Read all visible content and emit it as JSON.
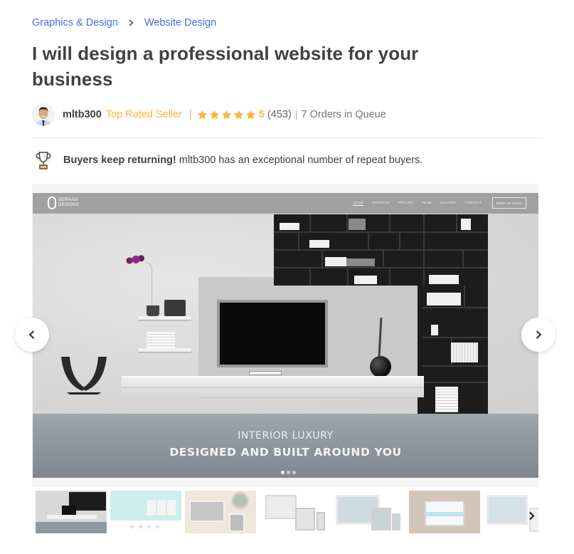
{
  "breadcrumb": {
    "items": [
      {
        "label": "Graphics & Design"
      },
      {
        "label": "Website Design"
      }
    ],
    "separator_icon": "chevron-right-icon"
  },
  "gig": {
    "title": "I will design a professional website for your business"
  },
  "seller": {
    "name": "mltb300",
    "level": "Top Rated Seller",
    "rating": {
      "stars": 5,
      "max_stars": 5,
      "score": "5",
      "count": "(453)"
    },
    "queue": "7 Orders in Queue",
    "avatar_icon": "avatar"
  },
  "promo": {
    "icon": "trophy-icon",
    "headline": "Buyers keep returning!",
    "text": "mltb300 has an exceptional number of repeat buyers."
  },
  "gallery": {
    "current_slide": 1,
    "total_dots": 3,
    "active_dot": 1,
    "slide": {
      "site_logo_line1": "BERHAM",
      "site_logo_line2": "DESIGNS",
      "site_nav": [
        "Home",
        "Services",
        "Pricing",
        "Team",
        "Gallery",
        "Contact"
      ],
      "site_nav_active": "Home",
      "site_cta": "Book us today",
      "caption_top": "INTERIOR LUXURY",
      "caption_main": "DESIGNED AND BUILT AROUND YOU"
    },
    "prev_icon": "chevron-left-icon",
    "next_icon": "chevron-right-icon",
    "thumbnails": [
      {
        "label": "Interior luxury homepage",
        "active": true
      },
      {
        "label": "Teal portfolio layout",
        "active": false
      },
      {
        "label": "Laptop and tablet mockup",
        "active": false
      },
      {
        "label": "Desktop and devices mockup",
        "active": false
      },
      {
        "label": "Responsive devices mockup",
        "active": false
      },
      {
        "label": "Laptop on desk mockup",
        "active": false
      },
      {
        "label": "Desktop and phone mockup",
        "active": false
      }
    ]
  },
  "colors": {
    "link": "#446ee7",
    "text": "#404145",
    "muted": "#74767e",
    "star": "#ffb33e",
    "divider": "#e4e5e7"
  }
}
